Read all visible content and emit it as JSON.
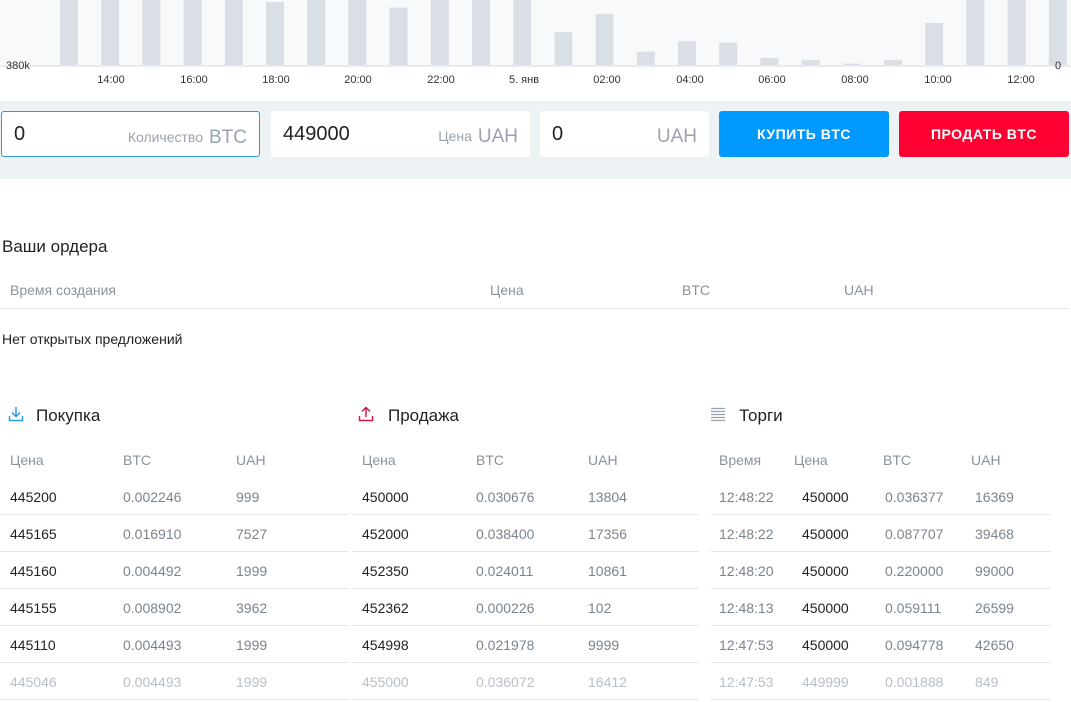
{
  "chart": {
    "y_left_label": "380k",
    "y_right_label": "0",
    "x_ticks": [
      "14:00",
      "16:00",
      "18:00",
      "20:00",
      "22:00",
      "5. янв",
      "02:00",
      "04:00",
      "06:00",
      "08:00",
      "10:00",
      "12:00"
    ],
    "bar_color": "#d9dfe5",
    "bars": [
      1.0,
      1.0,
      1.0,
      1.0,
      1.0,
      0.9,
      1.0,
      1.0,
      0.82,
      1.0,
      1.0,
      1.0,
      0.47,
      0.73,
      0.19,
      0.34,
      0.32,
      0.1,
      0.07,
      0.02,
      0.07,
      0.6,
      1.0,
      1.0,
      1.0
    ]
  },
  "form": {
    "amount_value": "0",
    "amount_label": "Количество",
    "amount_currency": "BTC",
    "price_value": "449000",
    "price_label": "Цена",
    "price_currency": "UAH",
    "total_value": "0",
    "total_currency": "UAH",
    "buy_label": "КУПИТЬ BTC",
    "sell_label": "ПРОДАТЬ BTC",
    "buy_color": "#0099ff",
    "sell_color": "#ff0033"
  },
  "orders": {
    "title": "Ваши ордера",
    "columns": [
      "Время создания",
      "Цена",
      "BTC",
      "UAH"
    ],
    "empty_text": "Нет открытых предложений"
  },
  "buy": {
    "title": "Покупка",
    "icon": "download-icon",
    "columns": [
      "Цена",
      "BTC",
      "UAH"
    ],
    "rows": [
      [
        "445200",
        "0.002246",
        "999"
      ],
      [
        "445165",
        "0.016910",
        "7527"
      ],
      [
        "445160",
        "0.004492",
        "1999"
      ],
      [
        "445155",
        "0.008902",
        "3962"
      ],
      [
        "445110",
        "0.004493",
        "1999"
      ],
      [
        "445046",
        "0.004493",
        "1999"
      ]
    ]
  },
  "sell": {
    "title": "Продажа",
    "icon": "upload-icon",
    "columns": [
      "Цена",
      "BTC",
      "UAH"
    ],
    "rows": [
      [
        "450000",
        "0.030676",
        "13804"
      ],
      [
        "452000",
        "0.038400",
        "17356"
      ],
      [
        "452350",
        "0.024011",
        "10861"
      ],
      [
        "452362",
        "0.000226",
        "102"
      ],
      [
        "454998",
        "0.021978",
        "9999"
      ],
      [
        "455000",
        "0.036072",
        "16412"
      ]
    ]
  },
  "trades": {
    "title": "Торги",
    "icon": "list-icon",
    "columns": [
      "Время",
      "Цена",
      "BTC",
      "UAH"
    ],
    "rows": [
      [
        "12:48:22",
        "450000",
        "0.036377",
        "16369"
      ],
      [
        "12:48:22",
        "450000",
        "0.087707",
        "39468"
      ],
      [
        "12:48:20",
        "450000",
        "0.220000",
        "99000"
      ],
      [
        "12:48:13",
        "450000",
        "0.059111",
        "26599"
      ],
      [
        "12:47:53",
        "450000",
        "0.094778",
        "42650"
      ],
      [
        "12:47:53",
        "449999",
        "0.001888",
        "849"
      ]
    ]
  }
}
